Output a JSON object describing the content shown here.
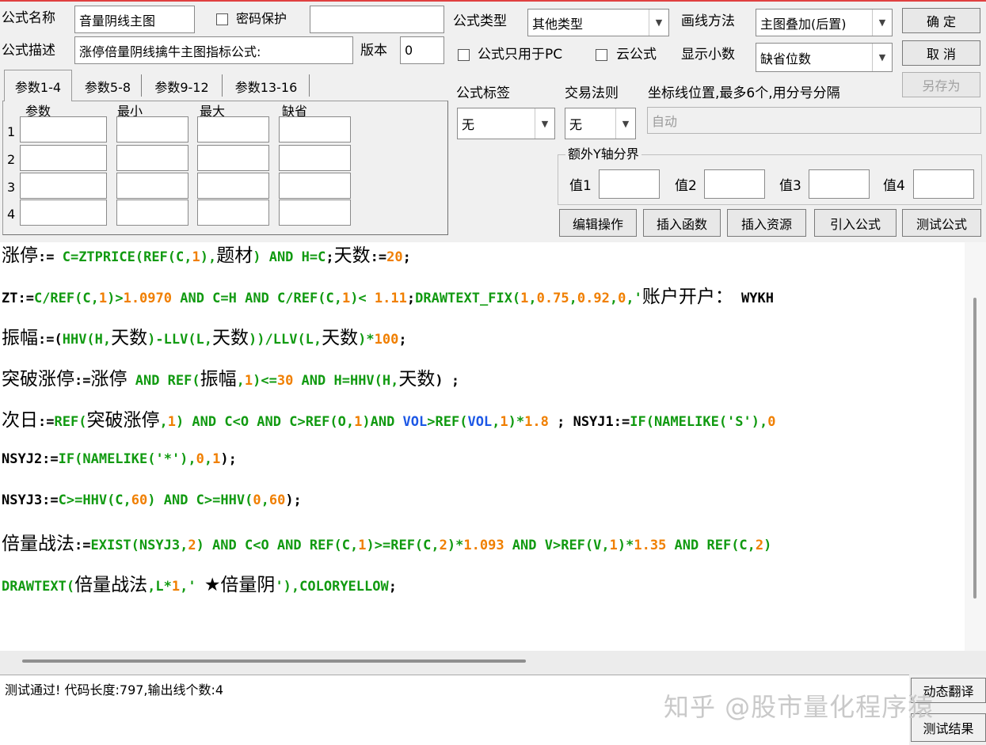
{
  "header": {
    "name_label": "公式名称",
    "name_value": "音量阴线主图",
    "password_label": "密码保护",
    "password_checked": false,
    "password_value": "",
    "desc_label": "公式描述",
    "desc_value": "涨停倍量阴线擒牛主图指标公式:",
    "version_label": "版本",
    "version_value": "0",
    "type_label": "公式类型",
    "type_value": "其他类型",
    "draw_label": "画线方法",
    "draw_value": "主图叠加(后置)",
    "pc_only_label": "公式只用于PC",
    "pc_only_checked": false,
    "cloud_label": "云公式",
    "cloud_checked": false,
    "decimals_label": "显示小数",
    "decimals_value": "缺省位数"
  },
  "buttons": {
    "ok": "确  定",
    "cancel": "取  消",
    "save_as": "另存为"
  },
  "tabs": [
    "参数1-4",
    "参数5-8",
    "参数9-12",
    "参数13-16"
  ],
  "params": {
    "headers": [
      "参数",
      "最小",
      "最大",
      "缺省"
    ],
    "rows": [
      "1",
      "2",
      "3",
      "4"
    ]
  },
  "tags": {
    "tag_label": "公式标签",
    "tag_value": "无",
    "rule_label": "交易法则",
    "rule_value": "无",
    "axis_label": "坐标线位置,最多6个,用分号分隔",
    "axis_value": "自动"
  },
  "extra_y": {
    "title": "额外Y轴分界",
    "v1": "值1",
    "v2": "值2",
    "v3": "值3",
    "v4": "值4"
  },
  "actions": {
    "edit": "编辑操作",
    "insert_func": "插入函数",
    "insert_res": "插入资源",
    "import": "引入公式",
    "test": "测试公式"
  },
  "code_lines": [
    [
      [
        "c",
        "涨停"
      ],
      [
        "k",
        ":= "
      ],
      [
        "g",
        "C=ZTPRICE("
      ],
      [
        "g",
        "REF(C,"
      ],
      [
        "o",
        "1"
      ],
      [
        "g",
        "),"
      ],
      [
        "c",
        "题材"
      ],
      [
        "g",
        ") AND H=C"
      ],
      [
        "k",
        ";"
      ],
      [
        "c",
        "天数"
      ],
      [
        "k",
        ":="
      ],
      [
        "o",
        "20"
      ],
      [
        "k",
        ";"
      ]
    ],
    [
      [
        "k",
        "ZT:="
      ],
      [
        "g",
        "C/REF(C,"
      ],
      [
        "o",
        "1"
      ],
      [
        "g",
        ")>"
      ],
      [
        "o",
        "1.0970"
      ],
      [
        "g",
        " AND C=H AND C/REF(C,"
      ],
      [
        "o",
        "1"
      ],
      [
        "g",
        ")< "
      ],
      [
        "o",
        "1.11"
      ],
      [
        "k",
        ";"
      ],
      [
        "g",
        "DRAWTEXT_FIX("
      ],
      [
        "o",
        "1"
      ],
      [
        "g",
        ","
      ],
      [
        "o",
        "0.75"
      ],
      [
        "g",
        ","
      ],
      [
        "o",
        "0.92"
      ],
      [
        "g",
        ","
      ],
      [
        "o",
        "0"
      ],
      [
        "g",
        ",'"
      ],
      [
        "c",
        "账户开户："
      ],
      [
        "k",
        " WYKH"
      ]
    ],
    [
      [
        "c",
        "振幅"
      ],
      [
        "k",
        ":=("
      ],
      [
        "g",
        "HHV(H,"
      ],
      [
        "c",
        "天数"
      ],
      [
        "g",
        ")-LLV(L,"
      ],
      [
        "c",
        "天数"
      ],
      [
        "g",
        "))/LLV(L,"
      ],
      [
        "c",
        "天数"
      ],
      [
        "g",
        ")*"
      ],
      [
        "o",
        "100"
      ],
      [
        "k",
        ";"
      ]
    ],
    [
      [
        "c",
        "突破涨停"
      ],
      [
        "k",
        ":="
      ],
      [
        "c",
        "涨停"
      ],
      [
        "g",
        " AND REF("
      ],
      [
        "c",
        "振幅"
      ],
      [
        "g",
        ","
      ],
      [
        "o",
        "1"
      ],
      [
        "g",
        ")<="
      ],
      [
        "o",
        "30"
      ],
      [
        "g",
        " AND H=HHV(H,"
      ],
      [
        "c",
        "天数"
      ],
      [
        "k",
        ") ;"
      ]
    ],
    [
      [
        "c",
        "次日"
      ],
      [
        "k",
        ":="
      ],
      [
        "g",
        "REF("
      ],
      [
        "c",
        "突破涨停"
      ],
      [
        "g",
        ","
      ],
      [
        "o",
        "1"
      ],
      [
        "g",
        ") AND C<O AND C>REF(O,"
      ],
      [
        "o",
        "1"
      ],
      [
        "g",
        ")AND "
      ],
      [
        "b",
        "VOL"
      ],
      [
        "g",
        ">REF("
      ],
      [
        "b",
        "VOL"
      ],
      [
        "g",
        ","
      ],
      [
        "o",
        "1"
      ],
      [
        "g",
        ")*"
      ],
      [
        "o",
        "1.8"
      ],
      [
        "k",
        " ; NSYJ1:="
      ],
      [
        "g",
        "IF(NAMELIKE('S'),"
      ],
      [
        "o",
        "0"
      ]
    ],
    [
      [
        "k",
        "NSYJ2:="
      ],
      [
        "g",
        "IF(NAMELIKE('*'),"
      ],
      [
        "o",
        "0"
      ],
      [
        "g",
        ","
      ],
      [
        "o",
        "1"
      ],
      [
        "k",
        ");"
      ]
    ],
    [
      [
        "k",
        "NSYJ3:="
      ],
      [
        "g",
        "C>=HHV(C,"
      ],
      [
        "o",
        "60"
      ],
      [
        "g",
        ") AND C>=HHV("
      ],
      [
        "o",
        "0"
      ],
      [
        "g",
        ","
      ],
      [
        "o",
        "60"
      ],
      [
        "k",
        ");"
      ]
    ],
    [
      [
        "c",
        "倍量战法"
      ],
      [
        "k",
        ":="
      ],
      [
        "g",
        "EXIST(NSYJ3,"
      ],
      [
        "o",
        "2"
      ],
      [
        "g",
        ") AND C<O AND REF(C,"
      ],
      [
        "o",
        "1"
      ],
      [
        "g",
        ")>=REF(C,"
      ],
      [
        "o",
        "2"
      ],
      [
        "g",
        ")*"
      ],
      [
        "o",
        "1.093"
      ],
      [
        "g",
        " AND V>REF(V,"
      ],
      [
        "o",
        "1"
      ],
      [
        "g",
        ")*"
      ],
      [
        "o",
        "1.35"
      ],
      [
        "g",
        " AND REF(C,"
      ],
      [
        "o",
        "2"
      ],
      [
        "g",
        ")"
      ]
    ],
    [
      [
        "g",
        "DRAWTEXT("
      ],
      [
        "c",
        "倍量战法"
      ],
      [
        "g",
        ",L*"
      ],
      [
        "o",
        "1"
      ],
      [
        "g",
        ",' "
      ],
      [
        "c",
        "★倍量阴"
      ],
      [
        "g",
        "'),COLORYELLOW"
      ],
      [
        "k",
        ";"
      ]
    ]
  ],
  "status": {
    "text": "测试通过! 代码长度:797,输出线个数:4",
    "translate_btn": "动态翻译",
    "result_btn": "测试结果"
  },
  "watermark": "知乎 @股市量化程序猿"
}
